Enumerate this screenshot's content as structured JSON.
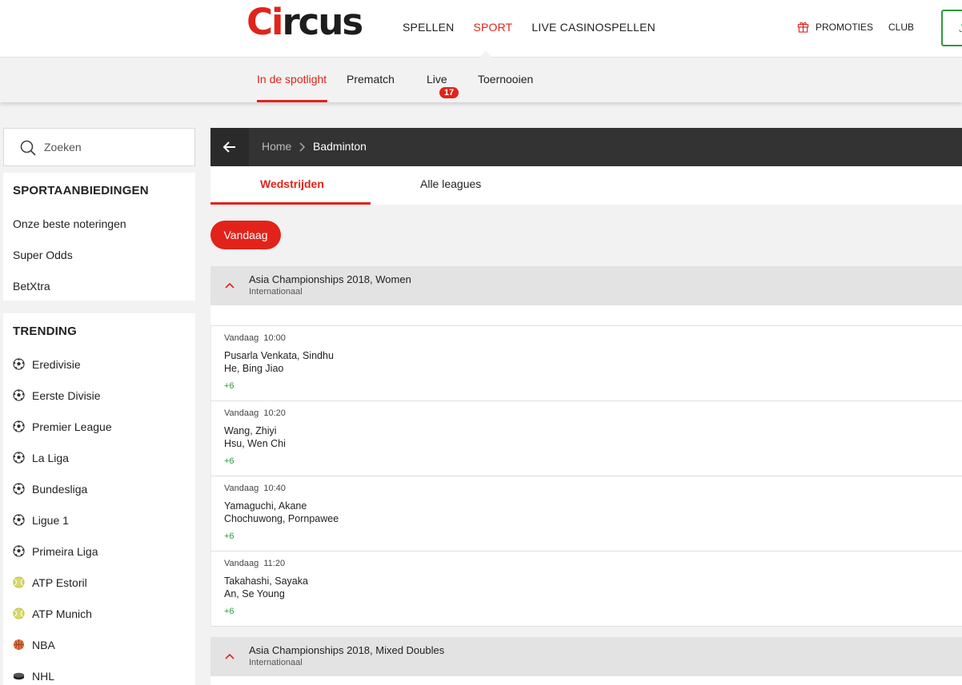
{
  "header": {
    "logo_text": "Circus",
    "nav": [
      "SPELLEN",
      "SPORT",
      "LIVE CASINOSPELLEN"
    ],
    "active_nav": "SPORT",
    "promotions_label": "PROMOTIES",
    "club_label": "CLUB",
    "login_label": "J"
  },
  "subnav": {
    "items": [
      "In de spotlight",
      "Prematch",
      "Live",
      "Toernooien"
    ],
    "active": "In de spotlight",
    "live_count": "17"
  },
  "sidebar": {
    "search_placeholder": "Zoeken",
    "offers_title": "SPORTAANBIEDINGEN",
    "offers": [
      "Onze beste noteringen",
      "Super Odds",
      "BetXtra"
    ],
    "trending_title": "TRENDING",
    "trending": [
      {
        "label": "Eredivisie",
        "icon": "soccer-ball-icon"
      },
      {
        "label": "Eerste Divisie",
        "icon": "soccer-ball-icon"
      },
      {
        "label": "Premier League",
        "icon": "soccer-ball-icon"
      },
      {
        "label": "La Liga",
        "icon": "soccer-ball-icon"
      },
      {
        "label": "Bundesliga",
        "icon": "soccer-ball-icon"
      },
      {
        "label": "Ligue 1",
        "icon": "soccer-ball-icon"
      },
      {
        "label": "Primeira Liga",
        "icon": "soccer-ball-icon"
      },
      {
        "label": "ATP Estoril",
        "icon": "tennis-ball-icon"
      },
      {
        "label": "ATP Munich",
        "icon": "tennis-ball-icon"
      },
      {
        "label": "NBA",
        "icon": "basketball-icon"
      },
      {
        "label": "NHL",
        "icon": "hockey-puck-icon"
      }
    ]
  },
  "breadcrumb": {
    "home": "Home",
    "current": "Badminton"
  },
  "tabs": {
    "matches": "Wedstrijden",
    "all_leagues": "Alle leagues"
  },
  "filter_chip": "Vandaag",
  "leagues": [
    {
      "name": "Asia Championships 2018, Women",
      "region": "Internationaal",
      "matches": [
        {
          "day": "Vandaag",
          "time": "10:00",
          "player1": "Pusarla Venkata, Sindhu",
          "player2": "He, Bing Jiao",
          "more": "+6"
        },
        {
          "day": "Vandaag",
          "time": "10:20",
          "player1": "Wang, Zhiyi",
          "player2": "Hsu, Wen Chi",
          "more": "+6"
        },
        {
          "day": "Vandaag",
          "time": "10:40",
          "player1": "Yamaguchi, Akane",
          "player2": "Chochuwong, Pornpawee",
          "more": "+6"
        },
        {
          "day": "Vandaag",
          "time": "11:20",
          "player1": "Takahashi, Sayaka",
          "player2": "An, Se Young",
          "more": "+6"
        }
      ]
    },
    {
      "name": "Asia Championships 2018, Mixed Doubles",
      "region": "Internationaal",
      "matches": []
    }
  ],
  "colors": {
    "brand_red": "#e2231a",
    "green": "#2e9b3c",
    "dark_bar": "#333333"
  }
}
